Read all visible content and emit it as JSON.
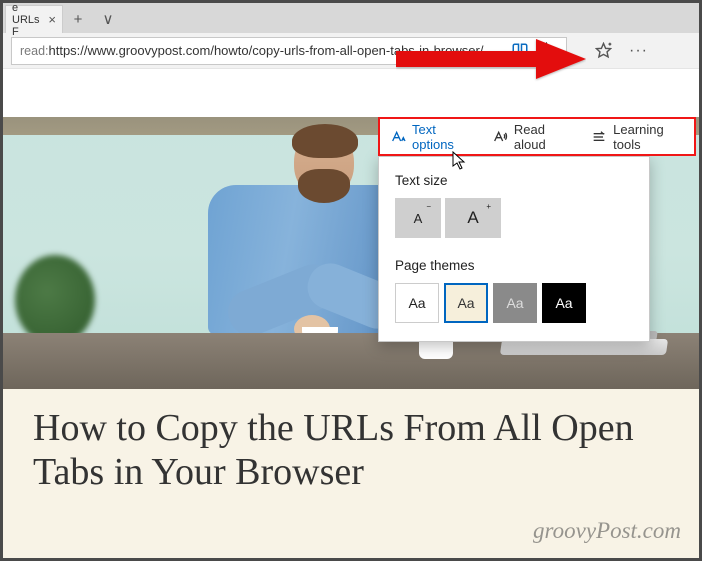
{
  "tab": {
    "title": "e URLs F",
    "close": "×"
  },
  "tabstrip": {
    "new": "+",
    "more": "∨"
  },
  "address": {
    "prefix": "read:",
    "url": "https://www.groovypost.com/howto/copy-urls-from-all-open-tabs-in-browser/"
  },
  "toolbar_icons": {
    "reading_view": "reading-view-icon",
    "favorite": "star-outline-icon",
    "fav_bar": "star-plus-icon",
    "more": "···"
  },
  "reader_bar": {
    "text_options": "Text options",
    "read_aloud": "Read aloud",
    "learning_tools": "Learning tools"
  },
  "popup": {
    "text_size_label": "Text size",
    "size_small": "A",
    "size_large": "A",
    "page_themes_label": "Page themes",
    "theme_glyph": "Aa"
  },
  "article": {
    "headline": "How to Copy the URLs From All Open Tabs in Your Browser"
  },
  "watermark": "groovyPost.com"
}
